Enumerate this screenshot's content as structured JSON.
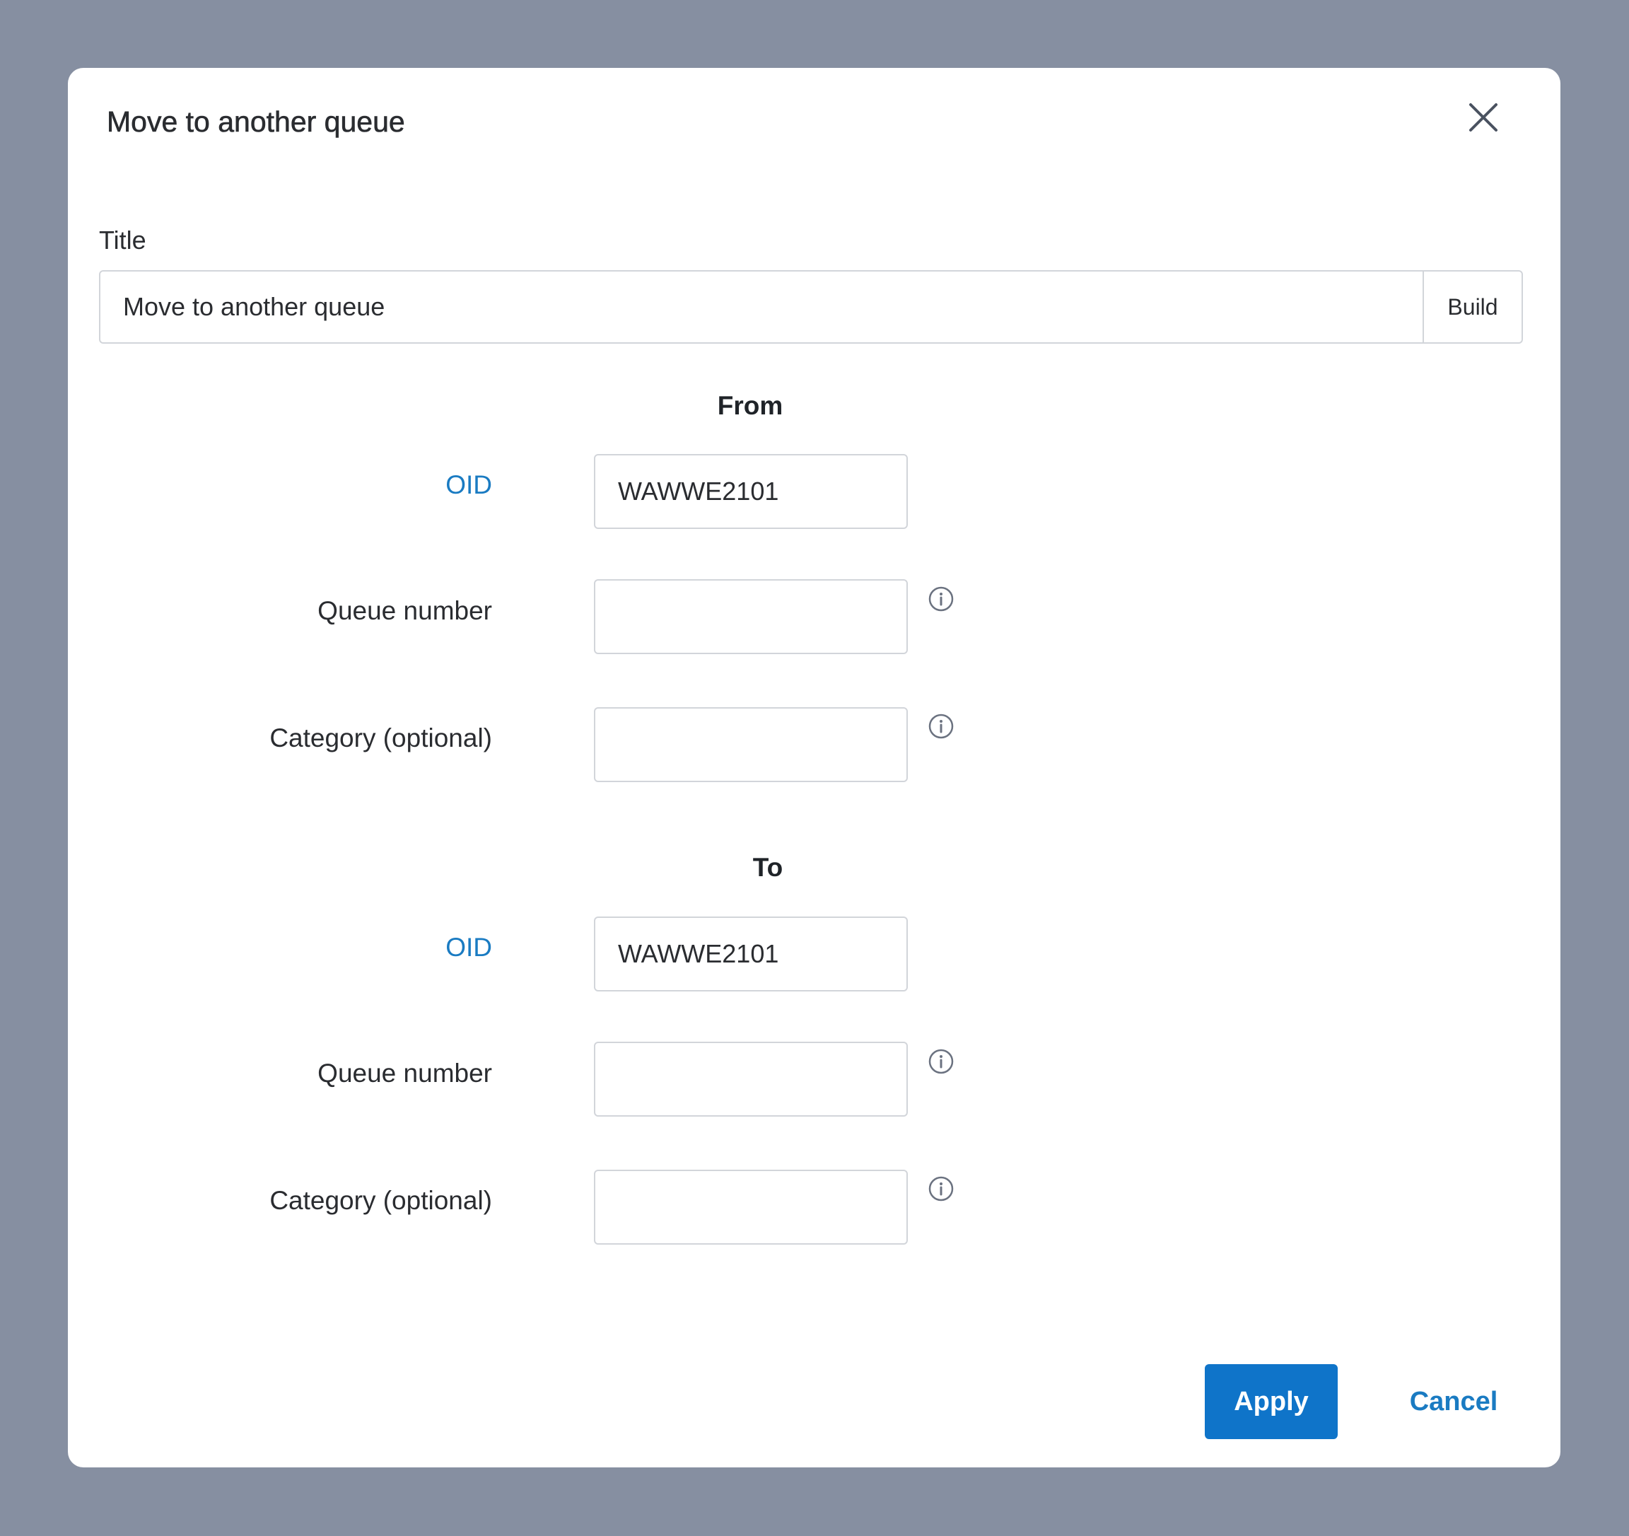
{
  "dialog": {
    "title": "Move to another queue",
    "close_icon": "close-icon"
  },
  "title_field": {
    "label": "Title",
    "value": "Move to another queue",
    "build_label": "Build"
  },
  "from": {
    "heading": "From",
    "oid": {
      "label": "OID",
      "value": "WAWWE2101"
    },
    "queue_number": {
      "label": "Queue number",
      "value": "",
      "info_icon": "info-icon"
    },
    "category": {
      "label": "Category (optional)",
      "value": "",
      "info_icon": "info-icon"
    }
  },
  "to": {
    "heading": "To",
    "oid": {
      "label": "OID",
      "value": "WAWWE2101"
    },
    "queue_number": {
      "label": "Queue number",
      "value": "",
      "info_icon": "info-icon"
    },
    "category": {
      "label": "Category (optional)",
      "value": "",
      "info_icon": "info-icon"
    }
  },
  "actions": {
    "apply_label": "Apply",
    "cancel_label": "Cancel"
  },
  "colors": {
    "backdrop": "#868fa1",
    "primary": "#0f74c9",
    "link": "#1a7bc2",
    "border": "#d2d5da"
  }
}
